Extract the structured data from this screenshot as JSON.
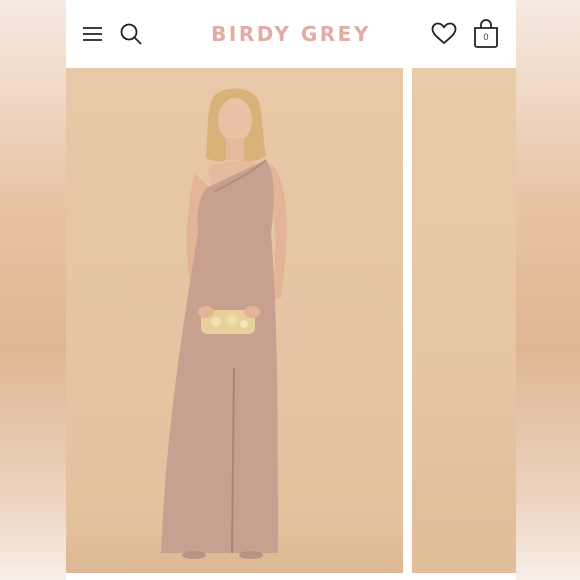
{
  "header": {
    "brand": "BIRDY GREY",
    "bag_count": "0",
    "icons": [
      "hamburger-menu-icon",
      "search-icon",
      "heart-icon",
      "shopping-bag-icon"
    ]
  },
  "product": {
    "main_image": "model-in-one-shoulder-dress-photo",
    "next_image": "next-product-photo-partial"
  },
  "colors": {
    "brand": "#e0aca3",
    "backdrop": "#e8c8a6",
    "dress": "#c7a08f"
  }
}
